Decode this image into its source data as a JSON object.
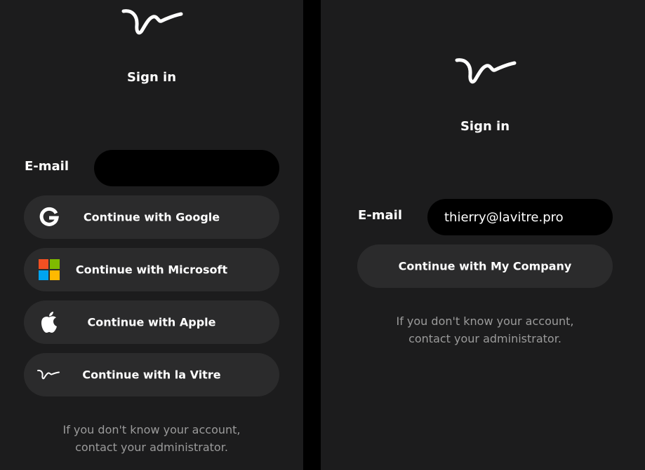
{
  "left": {
    "logo_icon": "la-vitre-logo-icon",
    "title": "Sign in",
    "email_label": "E-mail",
    "email_value": "",
    "buttons": [
      {
        "label": "Continue with Google",
        "icon": "google-icon"
      },
      {
        "label": "Continue with Microsoft",
        "icon": "microsoft-icon"
      },
      {
        "label": "Continue with Apple",
        "icon": "apple-icon"
      },
      {
        "label": "Continue with la Vitre",
        "icon": "la-vitre-icon"
      }
    ],
    "help_line1": "If you don't know your account,",
    "help_line2": "contact your administrator."
  },
  "right": {
    "logo_icon": "la-vitre-logo-icon",
    "title": "Sign in",
    "email_label": "E-mail",
    "email_value": "thierry@lavitre.pro",
    "button": {
      "label": "Continue with My Company"
    },
    "help_line1": "If you don't know your account,",
    "help_line2": "contact your administrator."
  },
  "colors": {
    "page_background": "#000000",
    "panel_background": "#1c1c1d",
    "button_background": "#2b2b2c",
    "input_background": "#000000",
    "help_text": "#9b9b9b",
    "microsoft_red": "#f25022",
    "microsoft_green": "#7fba00",
    "microsoft_blue": "#00a4ef",
    "microsoft_yellow": "#ffb900"
  }
}
